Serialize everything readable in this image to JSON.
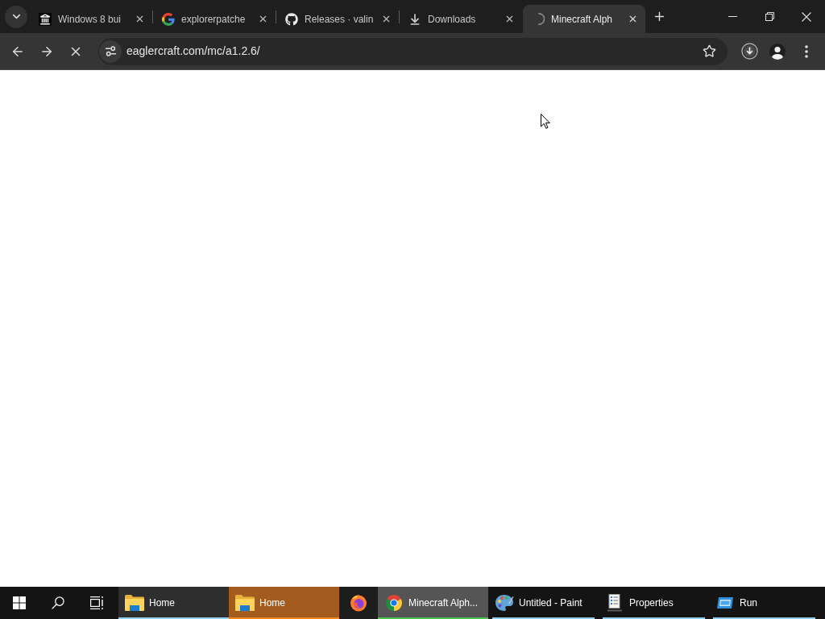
{
  "tab_strip": {
    "tabs": [
      {
        "title": "Windows 8 bui",
        "selected": false,
        "loading": false
      },
      {
        "title": "explorerpatche",
        "selected": false,
        "loading": false
      },
      {
        "title": "Releases · valin",
        "selected": false,
        "loading": false
      },
      {
        "title": "Downloads",
        "selected": false,
        "loading": false
      },
      {
        "title": "Minecraft Alph",
        "selected": true,
        "loading": true
      }
    ]
  },
  "toolbar": {
    "address": "eaglercraft.com/mc/a1.2.6/"
  },
  "taskbar": {
    "buttons": [
      {
        "label": "Home",
        "running": true,
        "hovered": true,
        "flashing": false,
        "selected": false
      },
      {
        "label": "Home",
        "running": true,
        "hovered": false,
        "flashing": true,
        "selected": false
      },
      {
        "running": false,
        "hovered": false,
        "flashing": false,
        "selected": false
      },
      {
        "label": "Minecraft Alph...",
        "running": true,
        "hovered": false,
        "flashing": false,
        "selected": true
      },
      {
        "label": "Untitled - Paint",
        "running": true,
        "hovered": false,
        "flashing": false,
        "selected": false
      },
      {
        "label": "Properties",
        "running": true,
        "hovered": false,
        "flashing": false,
        "selected": false
      },
      {
        "label": "Run",
        "running": true,
        "hovered": false,
        "flashing": false,
        "selected": false
      }
    ]
  }
}
